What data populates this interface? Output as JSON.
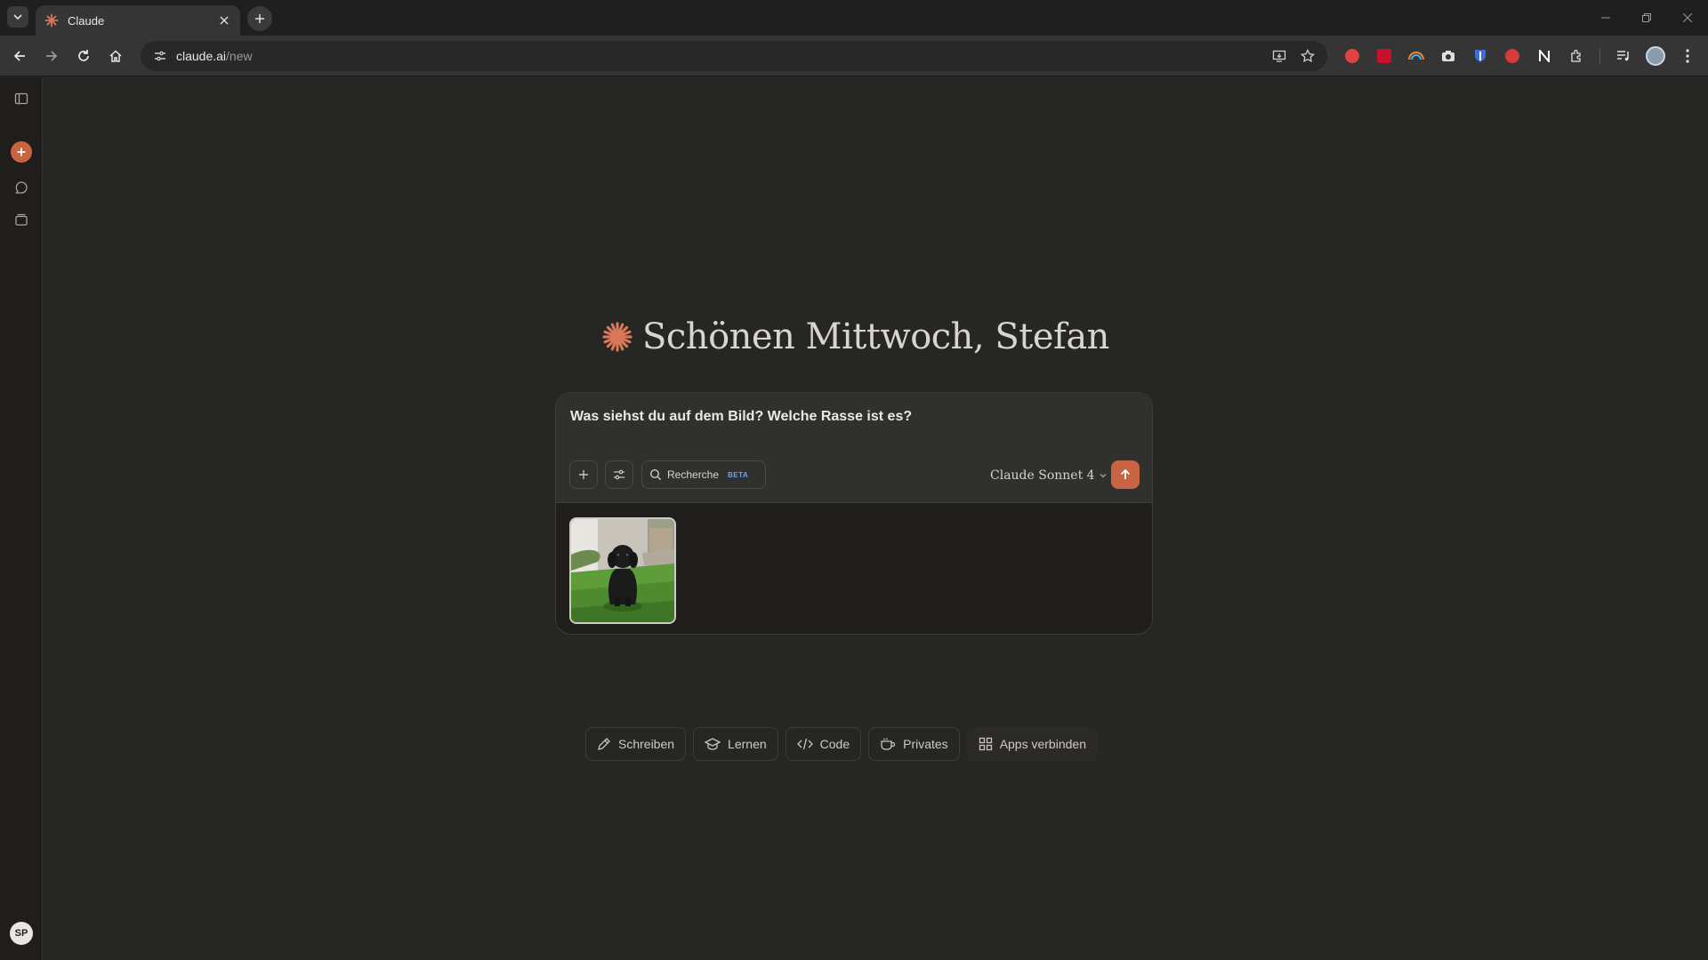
{
  "browser": {
    "tab_title": "Claude",
    "url_host": "claude.ai",
    "url_path": "/new"
  },
  "sidebar": {
    "user_initials": "SP",
    "icons": [
      "panel-toggle-icon",
      "new-chat-icon",
      "chats-icon",
      "projects-icon"
    ]
  },
  "main": {
    "greeting": "Schönen Mittwoch, Stefan",
    "composer": {
      "prompt_text": "Was siehst du auf dem Bild? Welche Rasse ist es?",
      "research_label": "Recherche",
      "research_badge": "BETA",
      "model_label": "Claude Sonnet 4"
    },
    "chips": [
      {
        "label": "Schreiben",
        "icon": "pencil-icon"
      },
      {
        "label": "Lernen",
        "icon": "graduation-cap-icon"
      },
      {
        "label": "Code",
        "icon": "code-icon"
      },
      {
        "label": "Privates",
        "icon": "coffee-icon"
      },
      {
        "label": "Apps verbinden",
        "icon": "apps-grid-icon"
      }
    ]
  },
  "colors": {
    "accent": "#c96442",
    "background": "#262624",
    "composer_bg": "#30302e"
  }
}
